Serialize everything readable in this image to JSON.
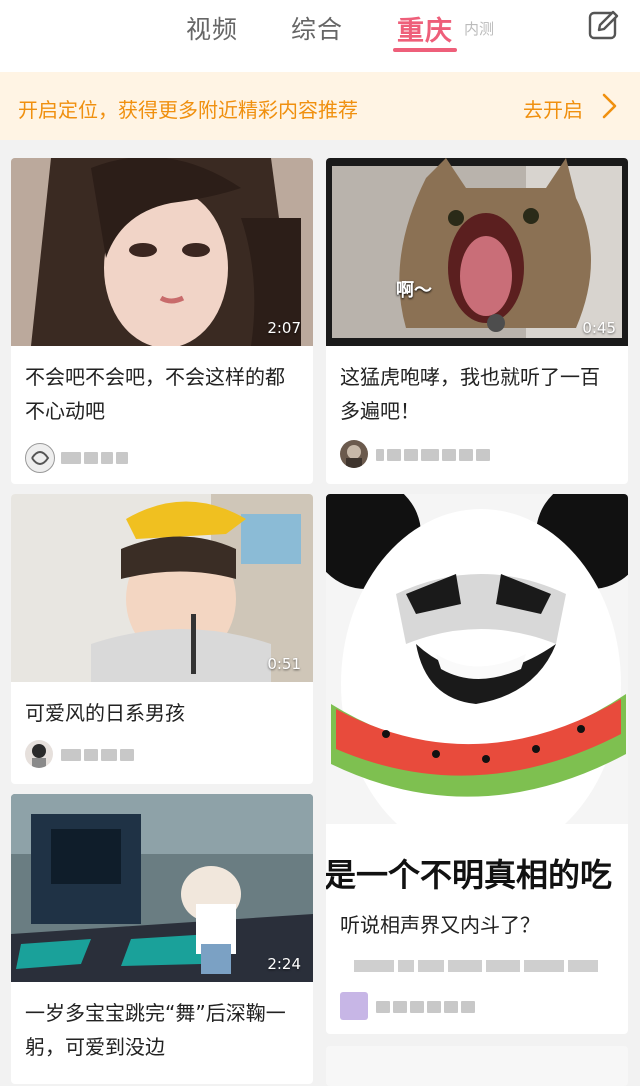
{
  "header": {
    "tabs": [
      {
        "label": "视频",
        "active": false
      },
      {
        "label": "综合",
        "active": false
      },
      {
        "label": "重庆",
        "active": true
      }
    ],
    "active_badge": "内测",
    "edit_icon": "edit-icon",
    "accent_color": "#ee5f7a"
  },
  "banner": {
    "text": "开启定位，获得更多附近精彩内容推荐",
    "action_label": "去开启",
    "color": "#f0900f"
  },
  "feed": {
    "cards": [
      {
        "title": "不会吧不会吧，不会这样的都不心动吧",
        "duration": "2:07"
      },
      {
        "title": "这猛虎咆哮，我也就听了一百多遍吧！",
        "duration": "0:45",
        "caption": "啊～"
      },
      {
        "title": "可爱风的日系男孩",
        "duration": "0:51"
      },
      {
        "title": "听说相声界又内斗了？",
        "caption": "是一个不明真相的吃"
      },
      {
        "title": "一岁多宝宝跳完“舞”后深鞠一躬，可爱到没边",
        "duration": "2:24"
      }
    ]
  }
}
